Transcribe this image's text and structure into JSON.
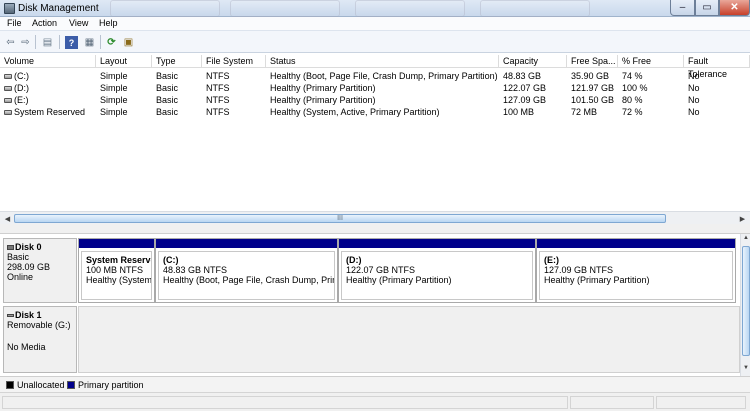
{
  "window": {
    "title": "Disk Management"
  },
  "menu": [
    "File",
    "Action",
    "View",
    "Help"
  ],
  "toolbar": [
    {
      "icon": "back-arrow-icon",
      "glyph": "⇦"
    },
    {
      "icon": "forward-arrow-icon",
      "glyph": "⇨"
    },
    {
      "icon": "console-tree-icon",
      "glyph": "▤"
    },
    {
      "icon": "help-icon",
      "glyph": "?"
    },
    {
      "icon": "properties-icon",
      "glyph": "▦"
    },
    {
      "icon": "refresh-icon",
      "glyph": "⟳"
    },
    {
      "icon": "export-list-icon",
      "glyph": "▣"
    }
  ],
  "volumes": {
    "columns": [
      "Volume",
      "Layout",
      "Type",
      "File System",
      "Status",
      "Capacity",
      "Free Spa...",
      "% Free",
      "Fault Tolerance"
    ],
    "rows": [
      [
        "(C:)",
        "Simple",
        "Basic",
        "NTFS",
        "Healthy (Boot, Page File, Crash Dump, Primary Partition)",
        "48.83 GB",
        "35.90 GB",
        "74 %",
        "No"
      ],
      [
        "(D:)",
        "Simple",
        "Basic",
        "NTFS",
        "Healthy (Primary Partition)",
        "122.07 GB",
        "121.97 GB",
        "100 %",
        "No"
      ],
      [
        "(E:)",
        "Simple",
        "Basic",
        "NTFS",
        "Healthy (Primary Partition)",
        "127.09 GB",
        "101.50 GB",
        "80 %",
        "No"
      ],
      [
        "System Reserved",
        "Simple",
        "Basic",
        "NTFS",
        "Healthy (System, Active, Primary Partition)",
        "100 MB",
        "72 MB",
        "72 %",
        "No"
      ]
    ]
  },
  "scrollbar_grip": "III",
  "disks": [
    {
      "name": "Disk 0",
      "type": "Basic",
      "size": "298.09 GB",
      "state": "Online",
      "partitions": [
        {
          "name": "System Reserve",
          "size": "100 MB NTFS",
          "status": "Healthy (System,"
        },
        {
          "name": "(C:)",
          "size": "48.83 GB NTFS",
          "status": "Healthy (Boot, Page File, Crash Dump, Prima"
        },
        {
          "name": "(D:)",
          "size": "122.07 GB NTFS",
          "status": "Healthy (Primary Partition)"
        },
        {
          "name": "(E:)",
          "size": "127.09 GB NTFS",
          "status": "Healthy (Primary Partition)"
        }
      ]
    },
    {
      "name": "Disk 1",
      "type": "Removable (G:)",
      "state": "No Media"
    }
  ],
  "legend": [
    {
      "label": "Unallocated",
      "color": "#000000"
    },
    {
      "label": "Primary partition",
      "color": "#00008b"
    }
  ],
  "colors": {
    "primary_partition": "#00008b",
    "close_button": "#c7402a"
  }
}
